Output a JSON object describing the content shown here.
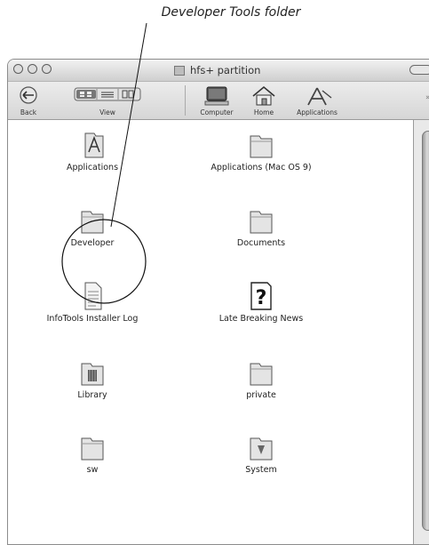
{
  "caption": "Developer Tools folder",
  "window": {
    "title": "hfs+ partition"
  },
  "toolbar": {
    "back": "Back",
    "view": "View",
    "computer": "Computer",
    "home": "Home",
    "applications": "Applications"
  },
  "items": [
    {
      "label": "Applications",
      "icon": "applications-folder-icon"
    },
    {
      "label": "Applications (Mac OS 9)",
      "icon": "folder-icon"
    },
    {
      "label": "Developer",
      "icon": "folder-icon"
    },
    {
      "label": "Documents",
      "icon": "folder-icon"
    },
    {
      "label": "InfoTools Installer Log",
      "icon": "document-icon"
    },
    {
      "label": "Late Breaking News",
      "icon": "help-document-icon"
    },
    {
      "label": "Library",
      "icon": "library-folder-icon"
    },
    {
      "label": "private",
      "icon": "folder-icon"
    },
    {
      "label": "sw",
      "icon": "folder-icon"
    },
    {
      "label": "System",
      "icon": "system-folder-icon"
    }
  ]
}
